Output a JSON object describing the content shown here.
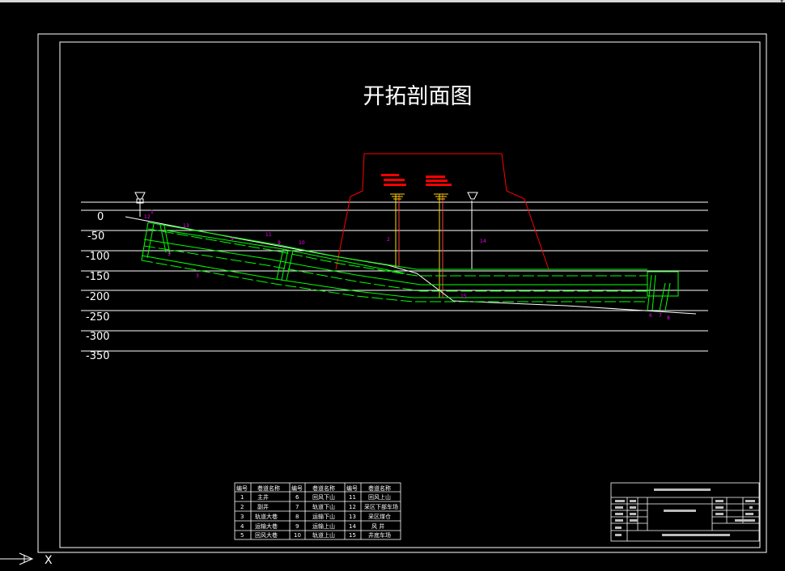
{
  "drawing": {
    "title": "开拓剖面图",
    "depth_labels": [
      "0",
      "-50",
      "-100",
      "-150",
      "-200",
      "-250",
      "-300",
      "-350"
    ],
    "roadway_numbers": [
      "1",
      "2",
      "3",
      "4",
      "5",
      "6",
      "7",
      "8",
      "9",
      "10",
      "11",
      "12",
      "13",
      "14",
      "15"
    ]
  },
  "legend_table": {
    "headers": [
      "编号",
      "巷道名称",
      "编号",
      "巷道名称",
      "编号",
      "巷道名称"
    ],
    "rows": [
      [
        "1",
        "主井",
        "6",
        "回风下山",
        "11",
        "回风上山"
      ],
      [
        "2",
        "副井",
        "7",
        "轨道下山",
        "12",
        "采区下部车场"
      ],
      [
        "3",
        "轨道大巷",
        "8",
        "运输下山",
        "13",
        "采区煤仓"
      ],
      [
        "4",
        "运输大巷",
        "9",
        "运输上山",
        "14",
        "风 井"
      ],
      [
        "5",
        "回风大巷",
        "10",
        "轨道上山",
        "15",
        "井底车场"
      ]
    ]
  },
  "colors": {
    "background": "#000000",
    "frame": "#ffffff",
    "roadway": "#00ff00",
    "surface": "#ff0000",
    "shaft": "#ffd700",
    "label": "#ff00ff"
  },
  "icons": {
    "ucs": "ucs-axis-icon",
    "headframe": "headframe-icon"
  },
  "ucs": {
    "x_label": "X"
  }
}
